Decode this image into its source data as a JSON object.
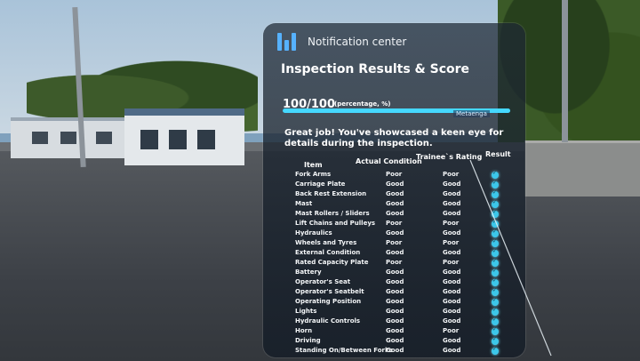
{
  "header": {
    "title": "Notification center"
  },
  "section": {
    "title": "Inspection Results & Score"
  },
  "score": {
    "value": "100/100",
    "unit": "(percentage, %)",
    "percent": 100
  },
  "watermark": "Metaenga",
  "message": "Great job! You've showcased a keen eye for details during the inspection.",
  "table": {
    "headers": {
      "item": "Item",
      "actual": "Actual Condition",
      "rating": "Trainee`s Rating",
      "result": "Result"
    },
    "rows": [
      {
        "item": "Fork Arms",
        "actual": "Poor",
        "rating": "Poor"
      },
      {
        "item": "Carriage Plate",
        "actual": "Good",
        "rating": "Good"
      },
      {
        "item": "Back Rest Extension",
        "actual": "Good",
        "rating": "Good"
      },
      {
        "item": "Mast",
        "actual": "Good",
        "rating": "Good"
      },
      {
        "item": "Mast Rollers / Sliders",
        "actual": "Good",
        "rating": "Good"
      },
      {
        "item": "Lift Chains and Pulleys",
        "actual": "Poor",
        "rating": "Poor"
      },
      {
        "item": "Hydraulics",
        "actual": "Good",
        "rating": "Good"
      },
      {
        "item": "Wheels and Tyres",
        "actual": "Poor",
        "rating": "Poor"
      },
      {
        "item": "External Condition",
        "actual": "Good",
        "rating": "Good"
      },
      {
        "item": "Rated Capacity Plate",
        "actual": "Poor",
        "rating": "Poor"
      },
      {
        "item": "Battery",
        "actual": "Good",
        "rating": "Good"
      },
      {
        "item": "Operator's Seat",
        "actual": "Good",
        "rating": "Good"
      },
      {
        "item": "Operator's Seatbelt",
        "actual": "Good",
        "rating": "Good"
      },
      {
        "item": "Operating Position",
        "actual": "Good",
        "rating": "Good"
      },
      {
        "item": "Lights",
        "actual": "Good",
        "rating": "Good"
      },
      {
        "item": "Hydraulic Controls",
        "actual": "Good",
        "rating": "Good"
      },
      {
        "item": "Horn",
        "actual": "Good",
        "rating": "Poor"
      },
      {
        "item": "Driving",
        "actual": "Good",
        "rating": "Good"
      },
      {
        "item": "Standing On/Between Forks",
        "actual": "Good",
        "rating": "Good"
      }
    ]
  },
  "colors": {
    "accent": "#45d8ff",
    "logo": "#56b2ff",
    "panel": "#1e2834"
  }
}
